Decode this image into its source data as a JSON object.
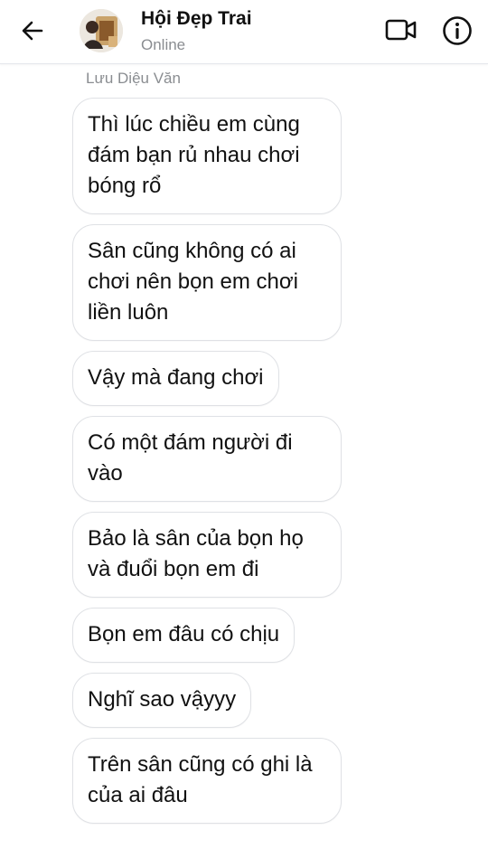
{
  "header": {
    "title": "Hội Đẹp Trai",
    "status": "Online",
    "back_icon": "arrow-left-icon",
    "video_icon": "video-camera-icon",
    "info_icon": "info-icon"
  },
  "thread": {
    "sender_name": "Lưu Diệu Văn",
    "messages": [
      "Thì lúc chiều em cùng đám bạn rủ nhau chơi bóng rổ",
      "Sân cũng không có ai chơi nên bọn em chơi liền luôn",
      "Vậy mà đang chơi",
      "Có một đám người đi vào",
      "Bảo là sân của bọn họ và đuổi bọn em đi",
      "Bọn em đâu có chịu",
      "Nghĩ sao vậyyy",
      "Trên sân cũng có ghi là của ai đâu"
    ]
  },
  "colors": {
    "background": "#ffffff",
    "bubble_border": "#dfe1e5",
    "secondary_text": "#8a8d91",
    "primary_text": "#111111"
  }
}
